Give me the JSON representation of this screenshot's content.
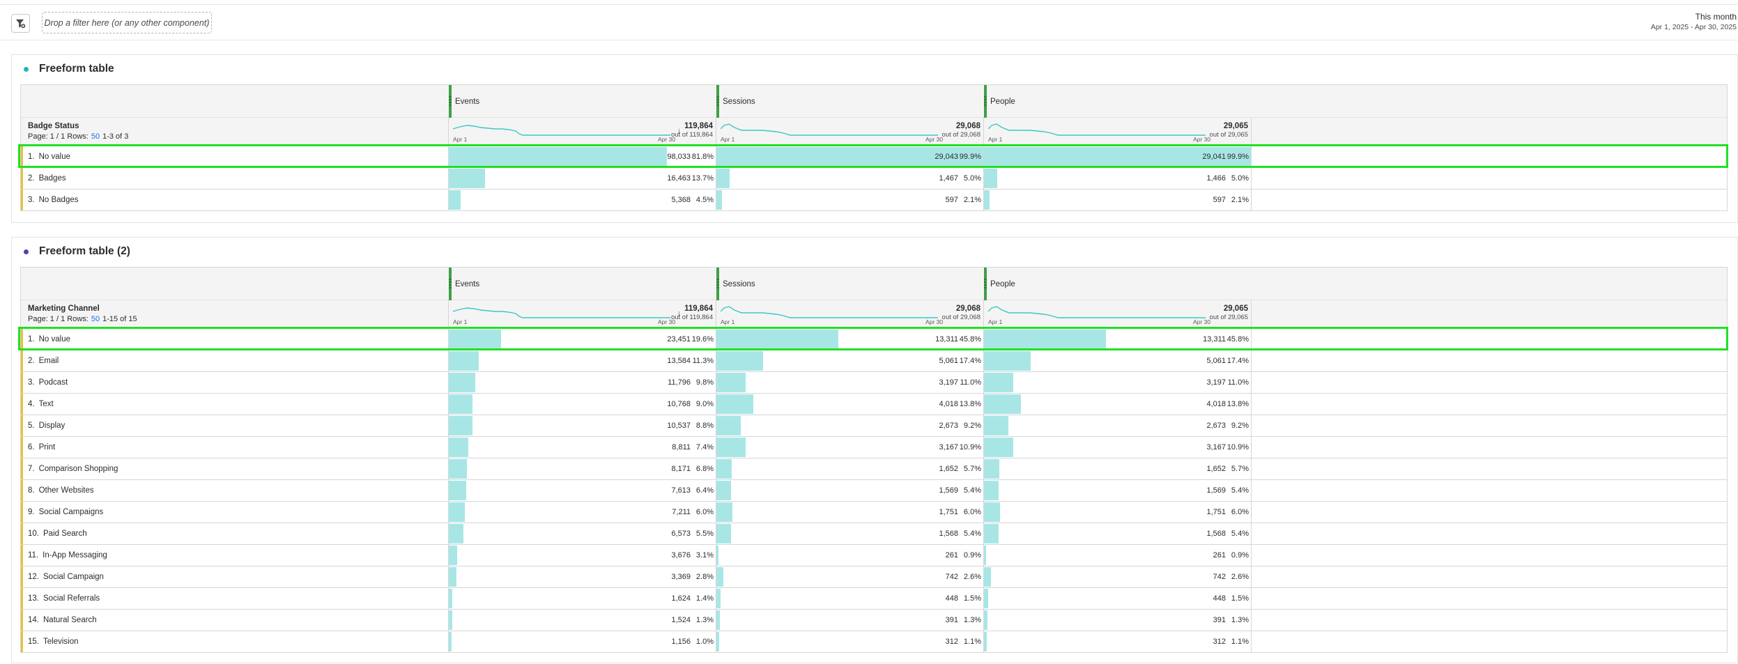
{
  "toolbar": {
    "filter_icon": "filter-add-icon",
    "dropzone_text": "Drop a filter here (or any other component)",
    "date_preset": "This month",
    "date_range": "Apr 1, 2025 - Apr 30, 2025"
  },
  "colors": {
    "bar": "#a8e6e6",
    "sparkline": "#3cc6c6",
    "metric_accent": "#3fa048",
    "row_accent": "#e8c13a",
    "selection": "#22e022",
    "panel1_dot": "#25b5b5",
    "panel2_dot": "#5b3fa6"
  },
  "panels": [
    {
      "title": "Freeform table",
      "dimension": "Badge Status",
      "page_label": "Page: 1 / 1  Rows:",
      "rows_value": "50",
      "range_label": "1-3 of 3",
      "metrics": [
        {
          "name": "Events",
          "total": "119,864",
          "out_of": "out of 119,864",
          "sorted": true,
          "sort_icon": "sort-descending-icon",
          "spark_start": "Apr 1",
          "spark_end": "Apr 30"
        },
        {
          "name": "Sessions",
          "total": "29,068",
          "out_of": "out of 29,068",
          "sorted": false,
          "spark_start": "Apr 1",
          "spark_end": "Apr 30"
        },
        {
          "name": "People",
          "total": "29,065",
          "out_of": "out of 29,065",
          "sorted": false,
          "spark_start": "Apr 1",
          "spark_end": "Apr 30"
        }
      ],
      "rows": [
        {
          "num": "1.",
          "label": "No value",
          "selected": true,
          "cells": [
            {
              "value": "98,033",
              "pct": "81.8%",
              "share": 0.818
            },
            {
              "value": "29,043",
              "pct": "99.9%",
              "share": 0.999
            },
            {
              "value": "29,041",
              "pct": "99.9%",
              "share": 0.999
            }
          ]
        },
        {
          "num": "2.",
          "label": "Badges",
          "cells": [
            {
              "value": "16,463",
              "pct": "13.7%",
              "share": 0.137
            },
            {
              "value": "1,467",
              "pct": "5.0%",
              "share": 0.05
            },
            {
              "value": "1,466",
              "pct": "5.0%",
              "share": 0.05
            }
          ]
        },
        {
          "num": "3.",
          "label": "No Badges",
          "cells": [
            {
              "value": "5,368",
              "pct": "4.5%",
              "share": 0.045
            },
            {
              "value": "597",
              "pct": "2.1%",
              "share": 0.021
            },
            {
              "value": "597",
              "pct": "2.1%",
              "share": 0.021
            }
          ]
        }
      ]
    },
    {
      "title": "Freeform table (2)",
      "dimension": "Marketing Channel",
      "page_label": "Page: 1 / 1  Rows:",
      "rows_value": "50",
      "range_label": "1-15 of 15",
      "metrics": [
        {
          "name": "Events",
          "total": "119,864",
          "out_of": "out of 119,864",
          "sorted": true,
          "sort_icon": "sort-descending-icon",
          "spark_start": "Apr 1",
          "spark_end": "Apr 30"
        },
        {
          "name": "Sessions",
          "total": "29,068",
          "out_of": "out of 29,068",
          "sorted": false,
          "spark_start": "Apr 1",
          "spark_end": "Apr 30"
        },
        {
          "name": "People",
          "total": "29,065",
          "out_of": "out of 29,065",
          "sorted": false,
          "spark_start": "Apr 1",
          "spark_end": "Apr 30"
        }
      ],
      "rows": [
        {
          "num": "1.",
          "label": "No value",
          "selected": true,
          "cells": [
            {
              "value": "23,451",
              "pct": "19.6%",
              "share": 0.196
            },
            {
              "value": "13,311",
              "pct": "45.8%",
              "share": 0.458
            },
            {
              "value": "13,311",
              "pct": "45.8%",
              "share": 0.458
            }
          ]
        },
        {
          "num": "2.",
          "label": "Email",
          "cells": [
            {
              "value": "13,584",
              "pct": "11.3%",
              "share": 0.113
            },
            {
              "value": "5,061",
              "pct": "17.4%",
              "share": 0.174
            },
            {
              "value": "5,061",
              "pct": "17.4%",
              "share": 0.174
            }
          ]
        },
        {
          "num": "3.",
          "label": "Podcast",
          "cells": [
            {
              "value": "11,796",
              "pct": "9.8%",
              "share": 0.098
            },
            {
              "value": "3,197",
              "pct": "11.0%",
              "share": 0.11
            },
            {
              "value": "3,197",
              "pct": "11.0%",
              "share": 0.11
            }
          ]
        },
        {
          "num": "4.",
          "label": "Text",
          "cells": [
            {
              "value": "10,768",
              "pct": "9.0%",
              "share": 0.09
            },
            {
              "value": "4,018",
              "pct": "13.8%",
              "share": 0.138
            },
            {
              "value": "4,018",
              "pct": "13.8%",
              "share": 0.138
            }
          ]
        },
        {
          "num": "5.",
          "label": "Display",
          "cells": [
            {
              "value": "10,537",
              "pct": "8.8%",
              "share": 0.088
            },
            {
              "value": "2,673",
              "pct": "9.2%",
              "share": 0.092
            },
            {
              "value": "2,673",
              "pct": "9.2%",
              "share": 0.092
            }
          ]
        },
        {
          "num": "6.",
          "label": "Print",
          "cells": [
            {
              "value": "8,811",
              "pct": "7.4%",
              "share": 0.074
            },
            {
              "value": "3,167",
              "pct": "10.9%",
              "share": 0.109
            },
            {
              "value": "3,167",
              "pct": "10.9%",
              "share": 0.109
            }
          ]
        },
        {
          "num": "7.",
          "label": "Comparison Shopping",
          "cells": [
            {
              "value": "8,171",
              "pct": "6.8%",
              "share": 0.068
            },
            {
              "value": "1,652",
              "pct": "5.7%",
              "share": 0.057
            },
            {
              "value": "1,652",
              "pct": "5.7%",
              "share": 0.057
            }
          ]
        },
        {
          "num": "8.",
          "label": "Other Websites",
          "cells": [
            {
              "value": "7,613",
              "pct": "6.4%",
              "share": 0.064
            },
            {
              "value": "1,569",
              "pct": "5.4%",
              "share": 0.054
            },
            {
              "value": "1,569",
              "pct": "5.4%",
              "share": 0.054
            }
          ]
        },
        {
          "num": "9.",
          "label": "Social Campaigns",
          "cells": [
            {
              "value": "7,211",
              "pct": "6.0%",
              "share": 0.06
            },
            {
              "value": "1,751",
              "pct": "6.0%",
              "share": 0.06
            },
            {
              "value": "1,751",
              "pct": "6.0%",
              "share": 0.06
            }
          ]
        },
        {
          "num": "10.",
          "label": "Paid Search",
          "cells": [
            {
              "value": "6,573",
              "pct": "5.5%",
              "share": 0.055
            },
            {
              "value": "1,568",
              "pct": "5.4%",
              "share": 0.054
            },
            {
              "value": "1,568",
              "pct": "5.4%",
              "share": 0.054
            }
          ]
        },
        {
          "num": "11.",
          "label": "In-App Messaging",
          "cells": [
            {
              "value": "3,676",
              "pct": "3.1%",
              "share": 0.031
            },
            {
              "value": "261",
              "pct": "0.9%",
              "share": 0.009
            },
            {
              "value": "261",
              "pct": "0.9%",
              "share": 0.009
            }
          ]
        },
        {
          "num": "12.",
          "label": "Social Campaign",
          "cells": [
            {
              "value": "3,369",
              "pct": "2.8%",
              "share": 0.028
            },
            {
              "value": "742",
              "pct": "2.6%",
              "share": 0.026
            },
            {
              "value": "742",
              "pct": "2.6%",
              "share": 0.026
            }
          ]
        },
        {
          "num": "13.",
          "label": "Social Referrals",
          "cells": [
            {
              "value": "1,624",
              "pct": "1.4%",
              "share": 0.014
            },
            {
              "value": "448",
              "pct": "1.5%",
              "share": 0.015
            },
            {
              "value": "448",
              "pct": "1.5%",
              "share": 0.015
            }
          ]
        },
        {
          "num": "14.",
          "label": "Natural Search",
          "cells": [
            {
              "value": "1,524",
              "pct": "1.3%",
              "share": 0.013
            },
            {
              "value": "391",
              "pct": "1.3%",
              "share": 0.013
            },
            {
              "value": "391",
              "pct": "1.3%",
              "share": 0.013
            }
          ]
        },
        {
          "num": "15.",
          "label": "Television",
          "cells": [
            {
              "value": "1,156",
              "pct": "1.0%",
              "share": 0.01
            },
            {
              "value": "312",
              "pct": "1.1%",
              "share": 0.011
            },
            {
              "value": "312",
              "pct": "1.1%",
              "share": 0.011
            }
          ]
        }
      ]
    }
  ]
}
